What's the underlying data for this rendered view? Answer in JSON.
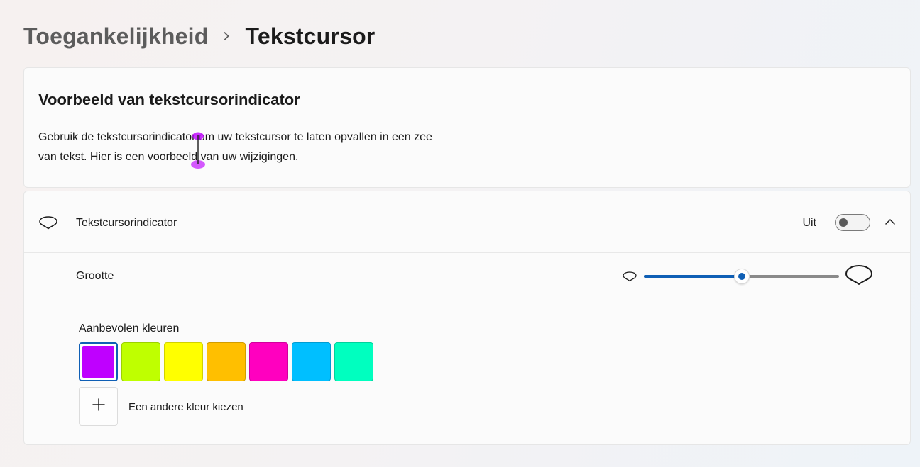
{
  "breadcrumb": {
    "parent": "Toegankelijkheid",
    "current": "Tekstcursor"
  },
  "preview": {
    "title": "Voorbeeld van tekstcursorindicator",
    "text": "Gebruik de tekstcursorindicator om uw tekstcursor te laten opvallen in een zee van tekst. Hier is een voorbeeld van uw wijzigingen."
  },
  "indicator": {
    "label": "Tekstcursorindicator",
    "toggle_state": "Uit",
    "toggle_on": false,
    "icon": "cursor-indicator-icon"
  },
  "size": {
    "label": "Grootte",
    "level": 0.5
  },
  "colors": {
    "label": "Aanbevolen kleuren",
    "swatches": [
      {
        "color": "#bf00ff",
        "selected": true
      },
      {
        "color": "#bfff00",
        "selected": false
      },
      {
        "color": "#ffff00",
        "selected": false
      },
      {
        "color": "#ffbf00",
        "selected": false
      },
      {
        "color": "#ff00bf",
        "selected": false
      },
      {
        "color": "#00bfff",
        "selected": false
      },
      {
        "color": "#00ffbf",
        "selected": false
      }
    ],
    "custom_label": "Een andere kleur kiezen"
  },
  "theme": {
    "accent": "#0f5fb5",
    "indicator_color": "#bf00ff"
  }
}
